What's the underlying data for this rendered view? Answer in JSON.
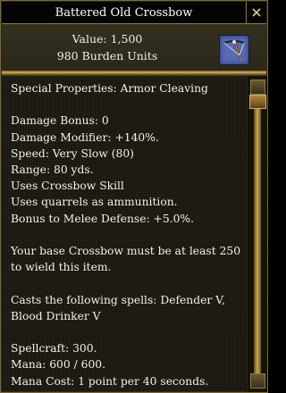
{
  "window": {
    "title": "Battered Old Crossbow",
    "close_icon": "close-x-icon"
  },
  "item": {
    "value_text": "Value: 1,500",
    "burden_text": "980 Burden Units",
    "icon": "crossbow-icon"
  },
  "properties": [
    "Special Properties: Armor Cleaving",
    "",
    "Damage Bonus: 0",
    "Damage Modifier: +140%.",
    "Speed: Very Slow (80)",
    "Range: 80 yds.",
    "Uses Crossbow Skill",
    "Uses quarrels as ammunition.",
    "Bonus to Melee Defense: +5.0%.",
    "",
    "Your base Crossbow must be at least 250",
    "to wield this item.",
    "",
    "Casts the following spells: Defender V,",
    "Blood Drinker V",
    "",
    "Spellcraft: 300.",
    "Mana: 600 / 600.",
    "Mana Cost: 1 point per 40 seconds."
  ],
  "colors": {
    "text": "#f4f2e6",
    "title_text": "#ffffff",
    "frame_gold": "#d6b25a",
    "icon_bg": "#5a6ab8"
  }
}
